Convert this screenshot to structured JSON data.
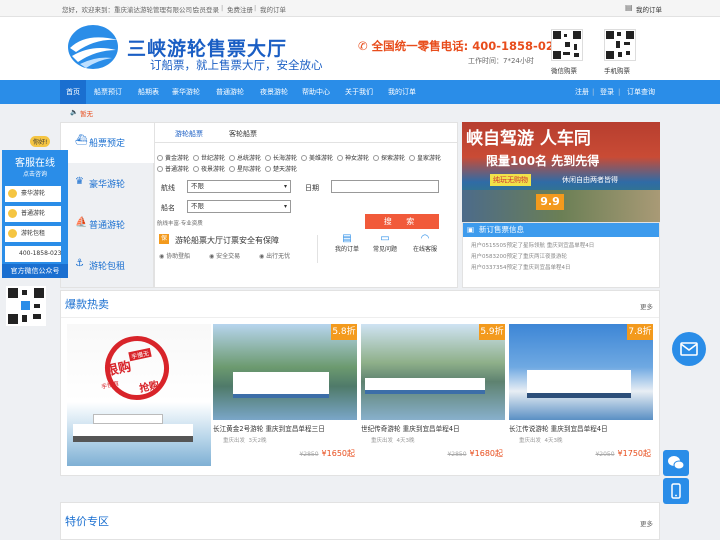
{
  "topbar": {
    "welcome": "您好，欢迎来到：重庆渝达游轮管理有限公司！",
    "login": "会员登录",
    "register": "免费注册",
    "my_orders": "我的订单",
    "sep": "|",
    "right_orders": "我的订单"
  },
  "header": {
    "title": "三峡游轮售票大厅",
    "slogan": "订船票，就上售票大厅，安全放心",
    "phone_label": "全国统一零售电话: ",
    "phone": "400-1858-023",
    "worktime": "工作时间：7*24小时",
    "qr1": "微信购票",
    "qr2": "手机购票"
  },
  "nav": {
    "items": [
      "首页",
      "船票预订",
      "船期表",
      "豪华游轮",
      "普通游轮",
      "夜景游轮",
      "帮助中心",
      "关于我们",
      "我的订单"
    ],
    "right": [
      "注册",
      "登录",
      "订单查询"
    ],
    "sep": "|"
  },
  "notice": "暂无",
  "side_tabs": [
    "船票预定",
    "豪华游轮",
    "普通游轮",
    "游轮包租"
  ],
  "search": {
    "tabs": [
      "游轮船票",
      "客轮船票"
    ],
    "ships": [
      "黄金游轮",
      "世纪游轮",
      "总统游轮",
      "长海游轮",
      "美维游轮",
      "神女游轮",
      "探索游轮",
      "皇家游轮",
      "普通游轮",
      "夜景游轮",
      "星际游轮",
      "楚天游轮"
    ],
    "route_label": "航线",
    "route_value": "不限",
    "date_label": "日期",
    "date_value": "",
    "ship_label": "船名",
    "ship_value": "不限",
    "hint": "航线丰富·专业资质",
    "button": "搜 索",
    "guarantee": "游轮船票大厅订票安全有保障",
    "guarantee_items": [
      "协助登船",
      "安全交易",
      "出行无忧"
    ],
    "links": [
      "我的订单",
      "常见问题",
      "在线客服"
    ]
  },
  "banner": {
    "headline": "峡自驾游 人车同",
    "sub": "限量100名 先到先得",
    "tag": "纯玩无购物",
    "tag2": "休闲自由两者皆得",
    "price": "9.9"
  },
  "news": {
    "title": "新订售票信息",
    "items": [
      "用户0515505预定了星际领航 重庆到宜昌单程4日",
      "用户0583200预定了重庆两江夜景游轮",
      "用户0337354预定了重庆到宜昌单程4日"
    ]
  },
  "kefu": {
    "hello": "你好!",
    "title": "客服在线",
    "sub": "点击咨询",
    "items": [
      "豪华游轮",
      "普通游轮",
      "游轮包租",
      "400-1858-023"
    ],
    "wechat": "官方微信公众号"
  },
  "hot": {
    "title": "爆款热卖",
    "more": "更多",
    "promo": [
      "限购",
      "抢购",
      "手快有",
      "手慢无"
    ],
    "cards": [
      {
        "discount": "5.8折",
        "name": "长江黄金2号游轮 重庆到宜昌单程三日",
        "from": "重庆出发",
        "days": "3天2晚",
        "old": "¥2850",
        "price": "¥1650起"
      },
      {
        "discount": "5.9折",
        "name": "世纪传奇游轮 重庆到宜昌单程4日",
        "from": "重庆出发",
        "days": "4天3晚",
        "old": "¥2850",
        "price": "¥1680起"
      },
      {
        "discount": "7.8折",
        "name": "长江传说游轮 重庆到宜昌单程4日",
        "from": "重庆出发",
        "days": "4天3晚",
        "old": "¥2050",
        "price": "¥1750起"
      }
    ]
  },
  "tejia": {
    "title": "特价专区",
    "more": "更多"
  },
  "colors": {
    "brand": "#1a5ec4",
    "nav": "#2a8de8",
    "accent": "#e84d1c",
    "button": "#f15a3a",
    "discount": "#f39a1d"
  }
}
